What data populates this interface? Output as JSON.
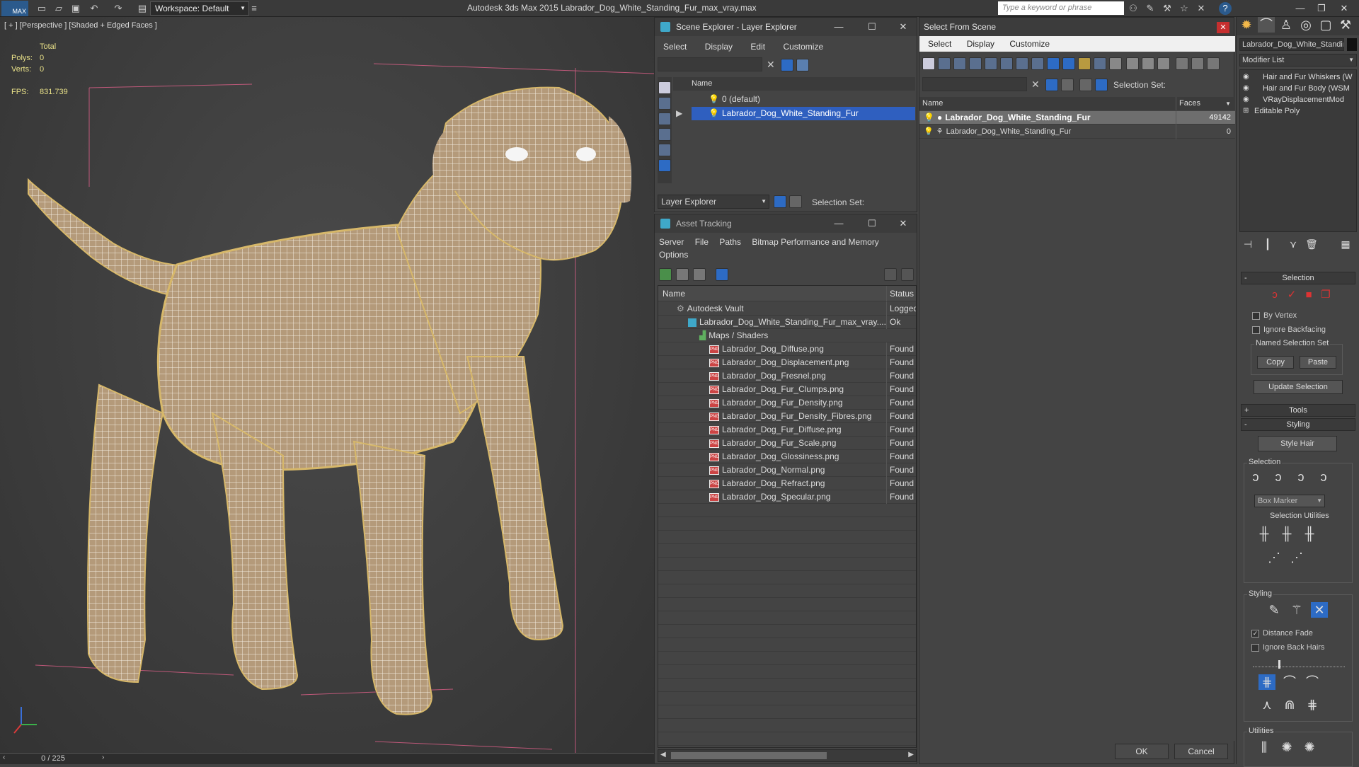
{
  "topbar": {
    "logo": "MAX",
    "workspace": "Workspace: Default",
    "title": "Autodesk 3ds Max  2015     Labrador_Dog_White_Standing_Fur_max_vray.max",
    "search_placeholder": "Type a keyword or phrase"
  },
  "viewport": {
    "label": "[ + ] [Perspective ] [Shaded + Edged Faces ]",
    "total_label": "Total",
    "polys_label": "Polys:",
    "polys_value": "0",
    "verts_label": "Verts:",
    "verts_value": "0",
    "fps_label": "FPS:",
    "fps_value": "831.739",
    "time": "0 / 225"
  },
  "scene_explorer": {
    "title": "Scene Explorer - Layer Explorer",
    "menu": [
      "Select",
      "Display",
      "Edit",
      "Customize"
    ],
    "col_name": "Name",
    "rows": [
      "0 (default)",
      "Labrador_Dog_White_Standing_Fur"
    ],
    "footer_label": "Layer Explorer",
    "selection_set": "Selection Set:"
  },
  "asset_tracking": {
    "title": "Asset Tracking",
    "menu": [
      "Server",
      "File",
      "Paths",
      "Bitmap Performance and Memory"
    ],
    "menu2": "Options",
    "col_name": "Name",
    "col_status": "Status",
    "vault": {
      "name": "Autodesk Vault",
      "status": "Logged"
    },
    "file": {
      "name": "Labrador_Dog_White_Standing_Fur_max_vray....",
      "status": "Ok"
    },
    "folder": "Maps / Shaders",
    "maps": [
      {
        "name": "Labrador_Dog_Diffuse.png",
        "status": "Found"
      },
      {
        "name": "Labrador_Dog_Displacement.png",
        "status": "Found"
      },
      {
        "name": "Labrador_Dog_Fresnel.png",
        "status": "Found"
      },
      {
        "name": "Labrador_Dog_Fur_Clumps.png",
        "status": "Found"
      },
      {
        "name": "Labrador_Dog_Fur_Density.png",
        "status": "Found"
      },
      {
        "name": "Labrador_Dog_Fur_Density_Fibres.png",
        "status": "Found"
      },
      {
        "name": "Labrador_Dog_Fur_Diffuse.png",
        "status": "Found"
      },
      {
        "name": "Labrador_Dog_Fur_Scale.png",
        "status": "Found"
      },
      {
        "name": "Labrador_Dog_Glossiness.png",
        "status": "Found"
      },
      {
        "name": "Labrador_Dog_Normal.png",
        "status": "Found"
      },
      {
        "name": "Labrador_Dog_Refract.png",
        "status": "Found"
      },
      {
        "name": "Labrador_Dog_Specular.png",
        "status": "Found"
      }
    ]
  },
  "select_from_scene": {
    "title": "Select From Scene",
    "menu": [
      "Select",
      "Display",
      "Customize"
    ],
    "selection_set": "Selection Set:",
    "col_name": "Name",
    "col_faces": "Faces",
    "rows": [
      {
        "name": "Labrador_Dog_White_Standing_Fur",
        "faces": "49142"
      },
      {
        "name": "Labrador_Dog_White_Standing_Fur",
        "faces": "0"
      }
    ],
    "ok": "OK",
    "cancel": "Cancel"
  },
  "command_panel": {
    "object_name": "Labrador_Dog_White_Standin",
    "modifier_list": "Modifier List",
    "stack": [
      "Hair and Fur Whiskers (W",
      "Hair and Fur Body (WSM",
      "VRayDisplacementMod",
      "Editable Poly"
    ],
    "selection_head": "Selection",
    "by_vertex": "By Vertex",
    "ignore_backfacing": "Ignore Backfacing",
    "named_sel": "Named Selection Set",
    "copy": "Copy",
    "paste": "Paste",
    "update_selection": "Update Selection",
    "tools_head": "Tools",
    "styling_head": "Styling",
    "style_hair": "Style Hair",
    "sub_selection": "Selection",
    "box_marker": "Box Marker",
    "selection_utilities": "Selection Utilities",
    "sub_styling": "Styling",
    "distance_fade": "Distance Fade",
    "ignore_back_hairs": "Ignore Back Hairs",
    "utilities": "Utilities"
  }
}
